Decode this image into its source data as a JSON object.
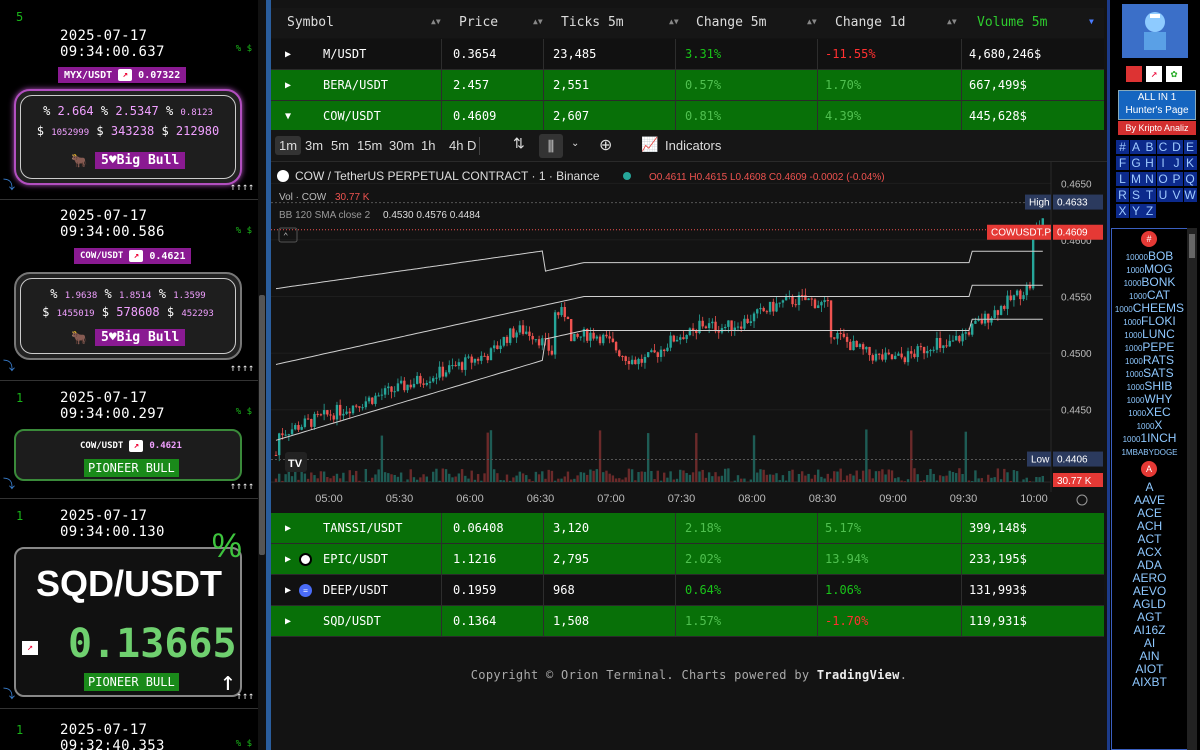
{
  "left_feed": {
    "events": [
      {
        "index": "5",
        "timestamp": "2025-07-17 09:34:00.637",
        "symbol": "MYX/USDT",
        "price": "0.07322",
        "pct1": "2.664",
        "pct2": "2.5347",
        "pct3": "0.8123",
        "vol1": "1052999",
        "vol2": "343238",
        "vol3": "212980",
        "count": "5",
        "badge": "Big Bull",
        "arrows": "↑↑↑↑"
      },
      {
        "index": "",
        "timestamp": "2025-07-17 09:34:00.586",
        "symbol": "COW/USDT",
        "price": "0.4621",
        "pct1": "1.9638",
        "pct2": "1.8514",
        "pct3": "1.3599",
        "vol1": "1455019",
        "vol2": "578608",
        "vol3": "452293",
        "count": "5",
        "badge": "Big Bull",
        "arrows": "↑↑↑↑"
      },
      {
        "index": "1",
        "timestamp": "2025-07-17 09:34:00.297",
        "symbol": "COW/USDT",
        "price": "0.4621",
        "badge": "PIONEER BULL",
        "arrows": "↑↑↑↑"
      },
      {
        "index": "1",
        "timestamp": "2025-07-17 09:34:00.130",
        "symbol": "SQD/USDT",
        "price": "0.13665",
        "badge": "PIONEER BULL",
        "arrows": "↑↑↑"
      },
      {
        "index": "1",
        "timestamp": "2025-07-17 09:32:40.353"
      }
    ],
    "pct_symbol": "%",
    "usd_symbol": "$",
    "pct_small": "% $"
  },
  "table": {
    "headers": [
      "Symbol",
      "Price",
      "Ticks 5m",
      "Change 5m",
      "Change 1d",
      "Volume 5m"
    ],
    "rows_top": [
      {
        "symbol": "M/USDT",
        "price": "0.3654",
        "ticks": "23,485",
        "c5": "3.31%",
        "c1d": "-11.55%",
        "vol": "4,680,246$",
        "style": "dark",
        "c5color": "#19c319",
        "c1dcolor": "#ff3030"
      },
      {
        "symbol": "BERA/USDT",
        "price": "2.457",
        "ticks": "2,551",
        "c5": "0.57%",
        "c1d": "1.70%",
        "vol": "667,499$",
        "style": "green",
        "c5color": "#50c050",
        "c1dcolor": "#50c050"
      },
      {
        "symbol": "COW/USDT",
        "price": "0.4609",
        "ticks": "2,607",
        "c5": "0.81%",
        "c1d": "4.39%",
        "vol": "445,628$",
        "style": "green",
        "c5color": "#50c050",
        "c1dcolor": "#50c050"
      }
    ],
    "rows_bottom": [
      {
        "symbol": "TANSSI/USDT",
        "price": "0.06408",
        "ticks": "3,120",
        "c5": "2.18%",
        "c1d": "5.17%",
        "vol": "399,148$",
        "style": "green",
        "c5color": "#50c050",
        "c1dcolor": "#50c050"
      },
      {
        "symbol": "EPIC/USDT",
        "price": "1.1216",
        "ticks": "2,795",
        "c5": "2.02%",
        "c1d": "13.94%",
        "vol": "233,195$",
        "style": "green",
        "c5color": "#50c050",
        "c1dcolor": "#50c050"
      },
      {
        "symbol": "DEEP/USDT",
        "price": "0.1959",
        "ticks": "968",
        "c5": "0.64%",
        "c1d": "1.06%",
        "vol": "131,993$",
        "style": "dark",
        "c5color": "#19c319",
        "c1dcolor": "#19c319"
      },
      {
        "symbol": "SQD/USDT",
        "price": "0.1364",
        "ticks": "1,508",
        "c5": "1.57%",
        "c1d": "-1.70%",
        "vol": "119,931$",
        "style": "green",
        "c5color": "#50c050",
        "c1dcolor": "#ff3030"
      }
    ]
  },
  "chart": {
    "timeframes": [
      "1m",
      "3m",
      "5m",
      "15m",
      "30m",
      "1h",
      "4h",
      "D"
    ],
    "active_tf": "1m",
    "indicators_label": "Indicators",
    "title": "COW / TetherUS PERPETUAL CONTRACT · 1 · Binance",
    "ohlc": {
      "o": "0.4611",
      "h": "0.4615",
      "l": "0.4608",
      "c": "0.4609",
      "chg": "-0.0002 (-0.04%)"
    },
    "vol_label": "Vol · COW",
    "vol_value": "30.77 K",
    "bb_label": "BB 120 SMA close 2",
    "bb_values": "0.4530  0.4576  0.4484",
    "high_label": "High",
    "high_value": "0.4633",
    "low_label": "Low",
    "low_value": "0.4406",
    "last_symbol": "COWUSDT.P",
    "last_value": "0.4609",
    "vol_tag": "30.77 K",
    "y_ticks": [
      "0.4650",
      "0.4600",
      "0.4550",
      "0.4500",
      "0.4450"
    ],
    "x_ticks": [
      "05:00",
      "05:30",
      "06:00",
      "06:30",
      "07:00",
      "07:30",
      "08:00",
      "08:30",
      "09:00",
      "09:30",
      "10:00"
    ],
    "colors": {
      "up": "#26a69a",
      "down": "#ef5350",
      "band": "#d0d0d0"
    }
  },
  "footer": {
    "prefix": "Copyright © Orion Terminal. Charts powered by ",
    "brand": "TradingView",
    "suffix": "."
  },
  "right_panel": {
    "allin_l1": "ALL IN 1",
    "allin_l2": "Hunter's Page",
    "kripto": "By Kripto Analiz",
    "letters": [
      "#",
      "A",
      "B",
      "C",
      "D",
      "E",
      "F",
      "G",
      "H",
      "I",
      "J",
      "K",
      "L",
      "M",
      "N",
      "O",
      "P",
      "Q",
      "R",
      "S",
      "T",
      "U",
      "V",
      "W",
      "X",
      "Y",
      "Z"
    ],
    "hash_badge": "#",
    "multi_items": [
      [
        "10000",
        "BOB"
      ],
      [
        "1000",
        "MOG"
      ],
      [
        "1000",
        "BONK"
      ],
      [
        "1000",
        "CAT"
      ],
      [
        "1000",
        "CHEEMS"
      ],
      [
        "1000",
        "FLOKI"
      ],
      [
        "1000",
        "LUNC"
      ],
      [
        "1000",
        "PEPE"
      ],
      [
        "1000",
        "RATS"
      ],
      [
        "1000",
        "SATS"
      ],
      [
        "1000",
        "SHIB"
      ],
      [
        "1000",
        "WHY"
      ],
      [
        "1000",
        "XEC"
      ],
      [
        "1000",
        "X"
      ],
      [
        "1000",
        "1INCH"
      ],
      [
        "1M",
        "BABYDOGE"
      ]
    ],
    "a_badge": "A",
    "a_items": [
      "A",
      "AAVE",
      "ACE",
      "ACH",
      "ACT",
      "ACX",
      "ADA",
      "AERO",
      "AEVO",
      "AGLD",
      "AGT",
      "AI16Z",
      "AI",
      "AIN",
      "AIOT",
      "AIXBT"
    ]
  }
}
